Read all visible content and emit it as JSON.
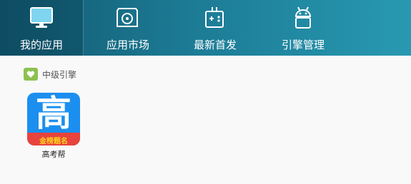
{
  "nav": {
    "tabs": [
      {
        "label": "我的应用",
        "icon": "monitor-icon",
        "active": true
      },
      {
        "label": "应用市场",
        "icon": "disc-box-icon",
        "active": false
      },
      {
        "label": "最新首发",
        "icon": "gamepad-icon",
        "active": false
      },
      {
        "label": "引擎管理",
        "icon": "android-icon",
        "active": false
      }
    ]
  },
  "engine": {
    "label": "中级引擎",
    "icon": "heart-badge-icon",
    "badge_color": "#8cc152"
  },
  "apps": [
    {
      "name": "高考帮",
      "icon_glyph": "高",
      "icon_strip": "金榜题名",
      "icon_color": "#1b8ff0",
      "strip_color": "#e8433d"
    }
  ],
  "colors": {
    "topbar_start": "#12596f",
    "topbar_end": "#2899b1",
    "background": "#f9f9f9"
  }
}
